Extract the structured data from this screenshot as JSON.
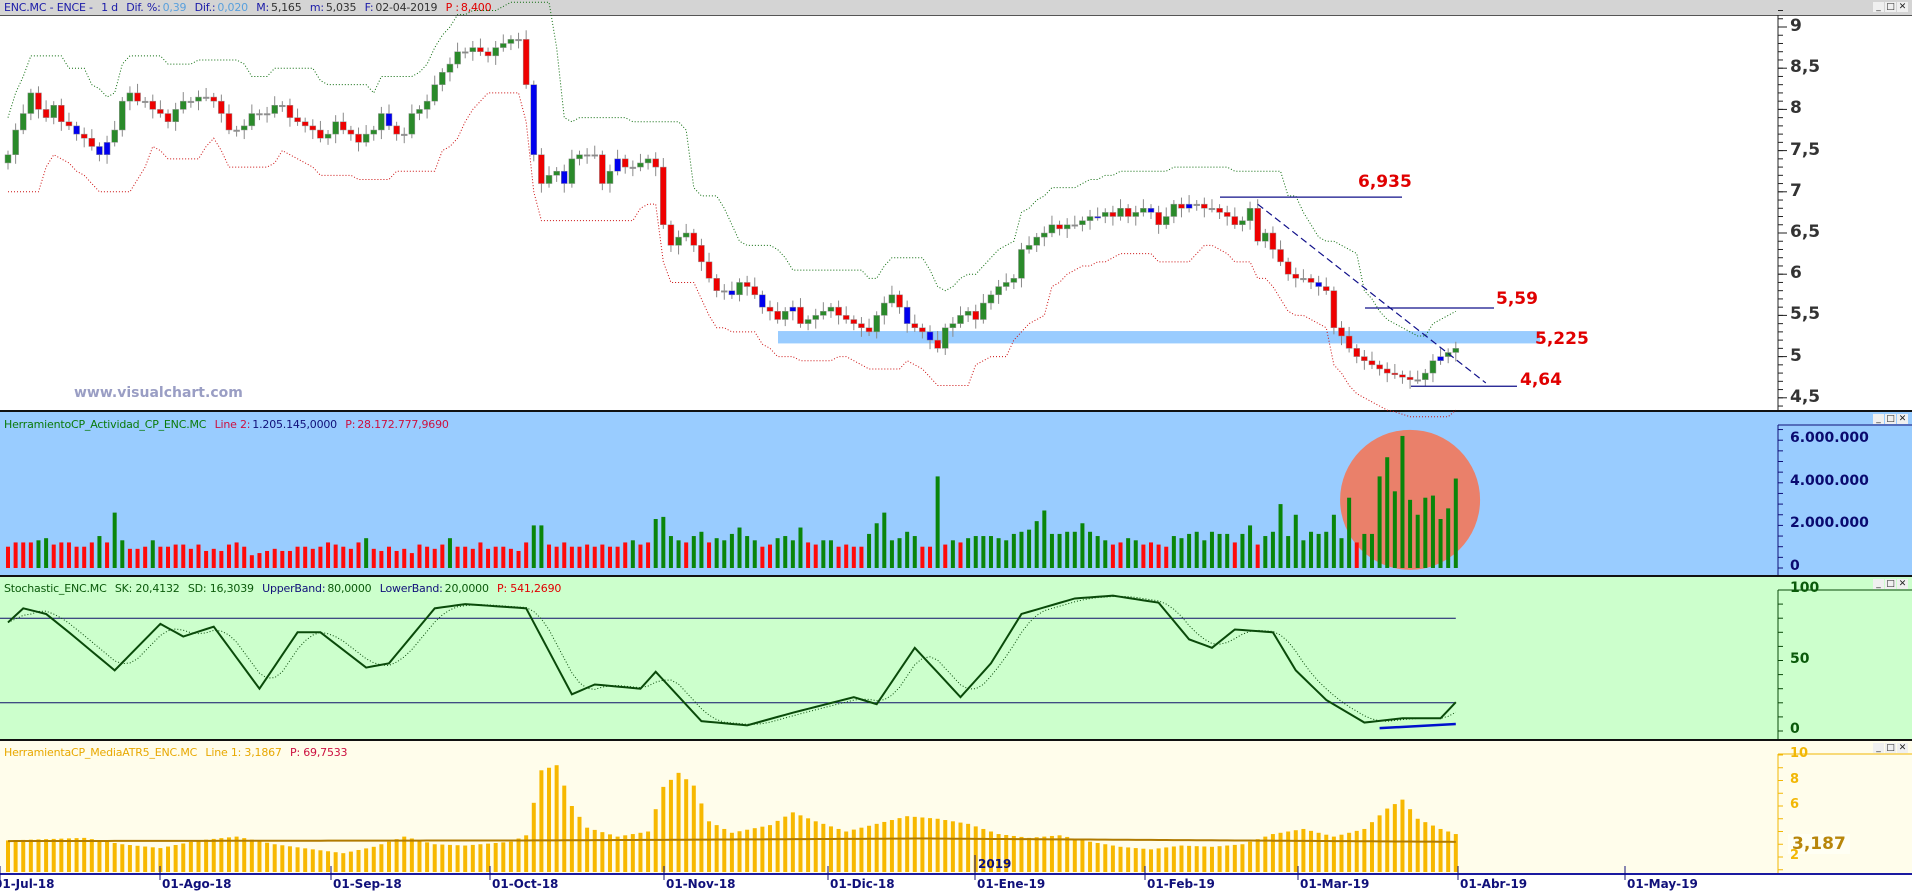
{
  "main": {
    "symbol": "ENC.MC - ENCE -",
    "timeframe": "1 d",
    "dif_pct_label": "Dif. %:",
    "dif_pct": "0,39",
    "dif_label": "Dif.:",
    "dif": "0,020",
    "max_label": "M:",
    "max": "5,165",
    "min_label": "m:",
    "min": "5,035",
    "date_label": "F:",
    "date": "02-04-2019",
    "p_label": "P :",
    "p": "8,400",
    "watermark": "www.visualchart.com"
  },
  "window_buttons": {
    "minimize": "_",
    "maximize": "□",
    "close": "✕"
  },
  "volume_panel": {
    "name": "HerramientoCP_Actividad_CP_ENC.MC",
    "line_label": "Line 2:",
    "line_value": "1.205.145,0000",
    "p_label": "P:",
    "p_value": "28.172.777,9690"
  },
  "stoch_panel": {
    "name": "Stochastic_ENC.MC",
    "sk": "SK: 20,4132",
    "sd": "SD: 16,3039",
    "upper_label": "UpperBand:",
    "upper": "80,0000",
    "lower_label": "LowerBand:",
    "lower": "20,0000",
    "p": "P: 541,2690"
  },
  "atr_panel": {
    "name": "HerramientaCP_MediaATR5_ENC.MC",
    "line": "Line 1: 3,1867",
    "p": "P: 69,7533",
    "current_label": "3,187"
  },
  "x_axis": {
    "labels": [
      "01-Jul-18",
      "01-Ago-18",
      "01-Sep-18",
      "01-Oct-18",
      "01-Nov-18",
      "01-Dic-18",
      "01-Ene-19",
      "01-Feb-19",
      "01-Mar-19",
      "01-Abr-19",
      "01-May-19"
    ],
    "year_marker": "2019"
  },
  "colors": {
    "up": "#2a8a2a",
    "down": "#ee0000",
    "inside": "#0000ee",
    "upper_band": "#0a6a0a",
    "lower_band": "#cc1010",
    "support_zone": "#99ccff",
    "annotation_line": "#10108a",
    "volume_up": "#0a850a",
    "volume_down": "#ff0a0a",
    "highlight_circle": "#ea806a",
    "stoch_k": "#0a4a0a",
    "stoch_band": "#10106a",
    "stoch_support": "#0010cc",
    "atr_bar": "#f7b800",
    "atr_line": "#b07a00"
  },
  "chart_data": [
    {
      "type": "candlestick",
      "title": "ENC.MC - ENCE - 1 d",
      "ylim": [
        4.4,
        9.2
      ],
      "y_ticks": [
        {
          "v": 9,
          "label": "9"
        },
        {
          "v": 8.5,
          "label": "8,5"
        },
        {
          "v": 8,
          "label": "8"
        },
        {
          "v": 7.5,
          "label": "7,5"
        },
        {
          "v": 7,
          "label": "7"
        },
        {
          "v": 6.5,
          "label": "6,5"
        },
        {
          "v": 6,
          "label": "6"
        },
        {
          "v": 5.5,
          "label": "5,5"
        },
        {
          "v": 5,
          "label": "5"
        },
        {
          "v": 4.5,
          "label": "4,5"
        }
      ],
      "close": [
        7.45,
        7.75,
        7.95,
        8.2,
        8.0,
        7.9,
        8.05,
        7.85,
        7.8,
        7.7,
        7.65,
        7.55,
        7.45,
        7.6,
        7.75,
        8.1,
        8.2,
        8.1,
        8.1,
        8.0,
        7.95,
        7.85,
        8.0,
        8.1,
        8.1,
        8.15,
        8.15,
        8.1,
        7.95,
        7.75,
        7.75,
        7.8,
        7.95,
        7.95,
        7.95,
        8.05,
        8.05,
        7.9,
        7.85,
        7.8,
        7.75,
        7.65,
        7.7,
        7.85,
        7.75,
        7.7,
        7.6,
        7.7,
        7.75,
        7.95,
        7.8,
        7.7,
        7.7,
        7.95,
        8.0,
        8.1,
        8.3,
        8.45,
        8.55,
        8.7,
        8.7,
        8.75,
        8.7,
        8.65,
        8.75,
        8.8,
        8.85,
        8.85,
        8.3,
        7.45,
        7.1,
        7.2,
        7.25,
        7.1,
        7.4,
        7.45,
        7.45,
        7.45,
        7.1,
        7.25,
        7.4,
        7.3,
        7.3,
        7.35,
        7.4,
        7.3,
        6.6,
        6.35,
        6.45,
        6.5,
        6.35,
        6.15,
        5.95,
        5.8,
        5.8,
        5.75,
        5.9,
        5.85,
        5.75,
        5.6,
        5.55,
        5.45,
        5.55,
        5.6,
        5.4,
        5.45,
        5.5,
        5.55,
        5.6,
        5.5,
        5.45,
        5.4,
        5.35,
        5.3,
        5.5,
        5.65,
        5.75,
        5.6,
        5.4,
        5.35,
        5.3,
        5.2,
        5.1,
        5.35,
        5.4,
        5.5,
        5.55,
        5.45,
        5.65,
        5.75,
        5.85,
        5.9,
        5.95,
        6.3,
        6.35,
        6.45,
        6.5,
        6.6,
        6.55,
        6.6,
        6.6,
        6.65,
        6.7,
        6.7,
        6.75,
        6.7,
        6.8,
        6.7,
        6.75,
        6.8,
        6.75,
        6.6,
        6.7,
        6.85,
        6.8,
        6.85,
        6.85,
        6.8,
        6.8,
        6.75,
        6.7,
        6.6,
        6.65,
        6.8,
        6.4,
        6.5,
        6.3,
        6.15,
        6.0,
        5.95,
        5.95,
        5.9,
        5.85,
        5.8,
        5.35,
        5.25,
        5.1,
        5.0,
        4.95,
        4.9,
        4.85,
        4.8,
        4.78,
        4.75,
        4.72,
        4.72,
        4.8,
        4.95,
        5.0,
        5.05,
        5.1
      ],
      "inside_bars": [
        9,
        12,
        13,
        50,
        69,
        73,
        80,
        95,
        99,
        103,
        118,
        121,
        143,
        150,
        155,
        172,
        188
      ],
      "levels": [
        {
          "value": 6.935,
          "label": "6,935"
        },
        {
          "value": 5.59,
          "label": "5,59"
        },
        {
          "value": 5.225,
          "label": "5,225",
          "zone": [
            5.16,
            5.31
          ]
        },
        {
          "value": 4.64,
          "label": "4,64"
        }
      ],
      "trendline": {
        "from": [
          164,
          6.85
        ],
        "to": [
          190,
          4.85
        ]
      }
    },
    {
      "type": "bar",
      "title": "HerramientoCP_Actividad_CP_ENC.MC",
      "ylim": [
        0,
        6500000
      ],
      "y_ticks": [
        {
          "v": 6000000,
          "label": "6.000.000"
        },
        {
          "v": 4000000,
          "label": "4.000.000"
        },
        {
          "v": 2000000,
          "label": "2.000.000"
        },
        {
          "v": 0,
          "label": "0"
        }
      ],
      "unit": "millions",
      "values": [
        1.0,
        1.2,
        1.2,
        1.2,
        1.3,
        1.4,
        1.1,
        1.2,
        1.2,
        1.0,
        1.0,
        1.2,
        1.5,
        1.2,
        2.6,
        1.3,
        0.9,
        0.9,
        1.0,
        1.3,
        1.0,
        1.0,
        1.1,
        1.1,
        0.9,
        1.1,
        0.8,
        0.9,
        0.8,
        1.1,
        1.2,
        1.0,
        0.6,
        0.7,
        0.8,
        0.9,
        0.8,
        0.8,
        1.0,
        1.0,
        0.9,
        1.0,
        1.2,
        1.1,
        1.0,
        0.9,
        1.2,
        1.4,
        0.9,
        0.8,
        1.0,
        0.8,
        0.9,
        0.7,
        1.1,
        1.0,
        0.9,
        1.1,
        1.4,
        1.0,
        1.0,
        0.9,
        1.2,
        0.9,
        1.0,
        1.0,
        0.9,
        0.8,
        1.2,
        2.0,
        2.0,
        1.1,
        1.0,
        1.2,
        1.0,
        1.0,
        1.1,
        1.0,
        1.1,
        1.0,
        1.0,
        1.2,
        1.3,
        1.1,
        1.2,
        2.3,
        2.4,
        1.5,
        1.3,
        1.2,
        1.5,
        1.7,
        1.2,
        1.4,
        1.3,
        1.6,
        1.9,
        1.5,
        1.3,
        1.0,
        1.1,
        1.4,
        1.5,
        1.3,
        1.9,
        1.2,
        1.1,
        1.3,
        1.3,
        1.0,
        1.1,
        1.0,
        1.0,
        1.6,
        2.1,
        2.6,
        1.3,
        1.4,
        1.7,
        1.5,
        1.0,
        1.0,
        4.3,
        1.1,
        1.3,
        1.2,
        1.4,
        1.5,
        1.5,
        1.5,
        1.4,
        1.3,
        1.6,
        1.7,
        1.8,
        2.2,
        2.7,
        1.6,
        1.6,
        1.7,
        1.7,
        2.1,
        1.7,
        1.5,
        1.3,
        1.1,
        1.2,
        1.4,
        1.3,
        1.1,
        1.2,
        1.1,
        1.0,
        1.5,
        1.4,
        1.6,
        1.7,
        1.3,
        1.7,
        1.6,
        1.6,
        1.2,
        1.6,
        2.0,
        1.1,
        1.5,
        1.7,
        3.0,
        1.5,
        2.5,
        1.3,
        1.7,
        1.6,
        1.7,
        2.5,
        1.4,
        3.3,
        1.2,
        1.6,
        1.6,
        4.3,
        5.2,
        3.6,
        6.2,
        3.2,
        2.5,
        3.3,
        3.4,
        2.3,
        2.8,
        4.2
      ],
      "green_threshold": 1.3,
      "highlight": {
        "center_bar": 184,
        "center_value": 3.2
      }
    },
    {
      "type": "line",
      "title": "Stochastic_ENC.MC",
      "ylim": [
        0,
        100
      ],
      "y_ticks": [
        {
          "v": 100,
          "label": "100"
        },
        {
          "v": 50,
          "label": "50"
        },
        {
          "v": 0,
          "label": "0"
        }
      ],
      "bands": [
        80,
        20
      ],
      "sk_keypoints": [
        [
          0,
          77
        ],
        [
          2,
          87
        ],
        [
          5,
          83
        ],
        [
          8,
          70
        ],
        [
          14,
          43
        ],
        [
          20,
          76
        ],
        [
          23,
          67
        ],
        [
          27,
          74
        ],
        [
          33,
          30
        ],
        [
          38,
          70
        ],
        [
          41,
          70
        ],
        [
          47,
          45
        ],
        [
          50,
          48
        ],
        [
          56,
          87
        ],
        [
          60,
          90
        ],
        [
          68,
          87
        ],
        [
          74,
          26
        ],
        [
          77,
          33
        ],
        [
          83,
          30
        ],
        [
          85,
          42
        ],
        [
          91,
          7
        ],
        [
          97,
          4
        ],
        [
          103,
          13
        ],
        [
          111,
          24
        ],
        [
          114,
          19
        ],
        [
          119,
          59
        ],
        [
          125,
          24
        ],
        [
          129,
          48
        ],
        [
          133,
          83
        ],
        [
          140,
          94
        ],
        [
          145,
          96
        ],
        [
          151,
          91
        ],
        [
          155,
          65
        ],
        [
          158,
          59
        ],
        [
          161,
          72
        ],
        [
          166,
          70
        ],
        [
          169,
          43
        ],
        [
          173,
          22
        ],
        [
          178,
          6
        ],
        [
          183,
          9
        ],
        [
          188,
          9
        ],
        [
          190,
          20.4
        ]
      ],
      "support_line": {
        "from": [
          180,
          2
        ],
        "to": [
          190,
          5
        ]
      }
    },
    {
      "type": "bar",
      "title": "HerramientaCP_MediaATR5_ENC.MC",
      "ylim": [
        0.8,
        10
      ],
      "y_ticks": [
        {
          "v": 10,
          "label": "10"
        },
        {
          "v": 8,
          "label": "8"
        },
        {
          "v": 6,
          "label": "6"
        },
        {
          "v": 2,
          "label": "2"
        }
      ],
      "atr_keypoints": [
        [
          0,
          3.3
        ],
        [
          5,
          3.4
        ],
        [
          10,
          3.5
        ],
        [
          15,
          3.0
        ],
        [
          20,
          2.7
        ],
        [
          25,
          3.3
        ],
        [
          30,
          3.6
        ],
        [
          35,
          3.0
        ],
        [
          40,
          2.6
        ],
        [
          44,
          2.3
        ],
        [
          48,
          2.8
        ],
        [
          52,
          3.6
        ],
        [
          56,
          3.0
        ],
        [
          60,
          2.9
        ],
        [
          64,
          3.1
        ],
        [
          66,
          3.2
        ],
        [
          68,
          3.7
        ],
        [
          70,
          8.8
        ],
        [
          72,
          9.2
        ],
        [
          74,
          6.0
        ],
        [
          76,
          4.3
        ],
        [
          80,
          3.6
        ],
        [
          84,
          4.0
        ],
        [
          86,
          7.5
        ],
        [
          88,
          8.6
        ],
        [
          90,
          7.6
        ],
        [
          92,
          4.8
        ],
        [
          95,
          3.9
        ],
        [
          100,
          4.5
        ],
        [
          103,
          5.5
        ],
        [
          106,
          4.8
        ],
        [
          110,
          4.0
        ],
        [
          114,
          4.6
        ],
        [
          118,
          5.2
        ],
        [
          122,
          5.0
        ],
        [
          126,
          4.6
        ],
        [
          130,
          3.8
        ],
        [
          134,
          3.5
        ],
        [
          138,
          3.7
        ],
        [
          142,
          3.2
        ],
        [
          146,
          2.8
        ],
        [
          150,
          2.6
        ],
        [
          154,
          2.9
        ],
        [
          158,
          2.8
        ],
        [
          162,
          3.0
        ],
        [
          166,
          3.8
        ],
        [
          170,
          4.2
        ],
        [
          174,
          3.6
        ],
        [
          178,
          4.2
        ],
        [
          181,
          5.8
        ],
        [
          183,
          6.5
        ],
        [
          185,
          5.0
        ],
        [
          188,
          4.2
        ],
        [
          190,
          3.8
        ]
      ],
      "avg_keypoints": [
        [
          0,
          3.25
        ],
        [
          70,
          3.3
        ],
        [
          120,
          3.45
        ],
        [
          190,
          3.19
        ]
      ]
    }
  ]
}
